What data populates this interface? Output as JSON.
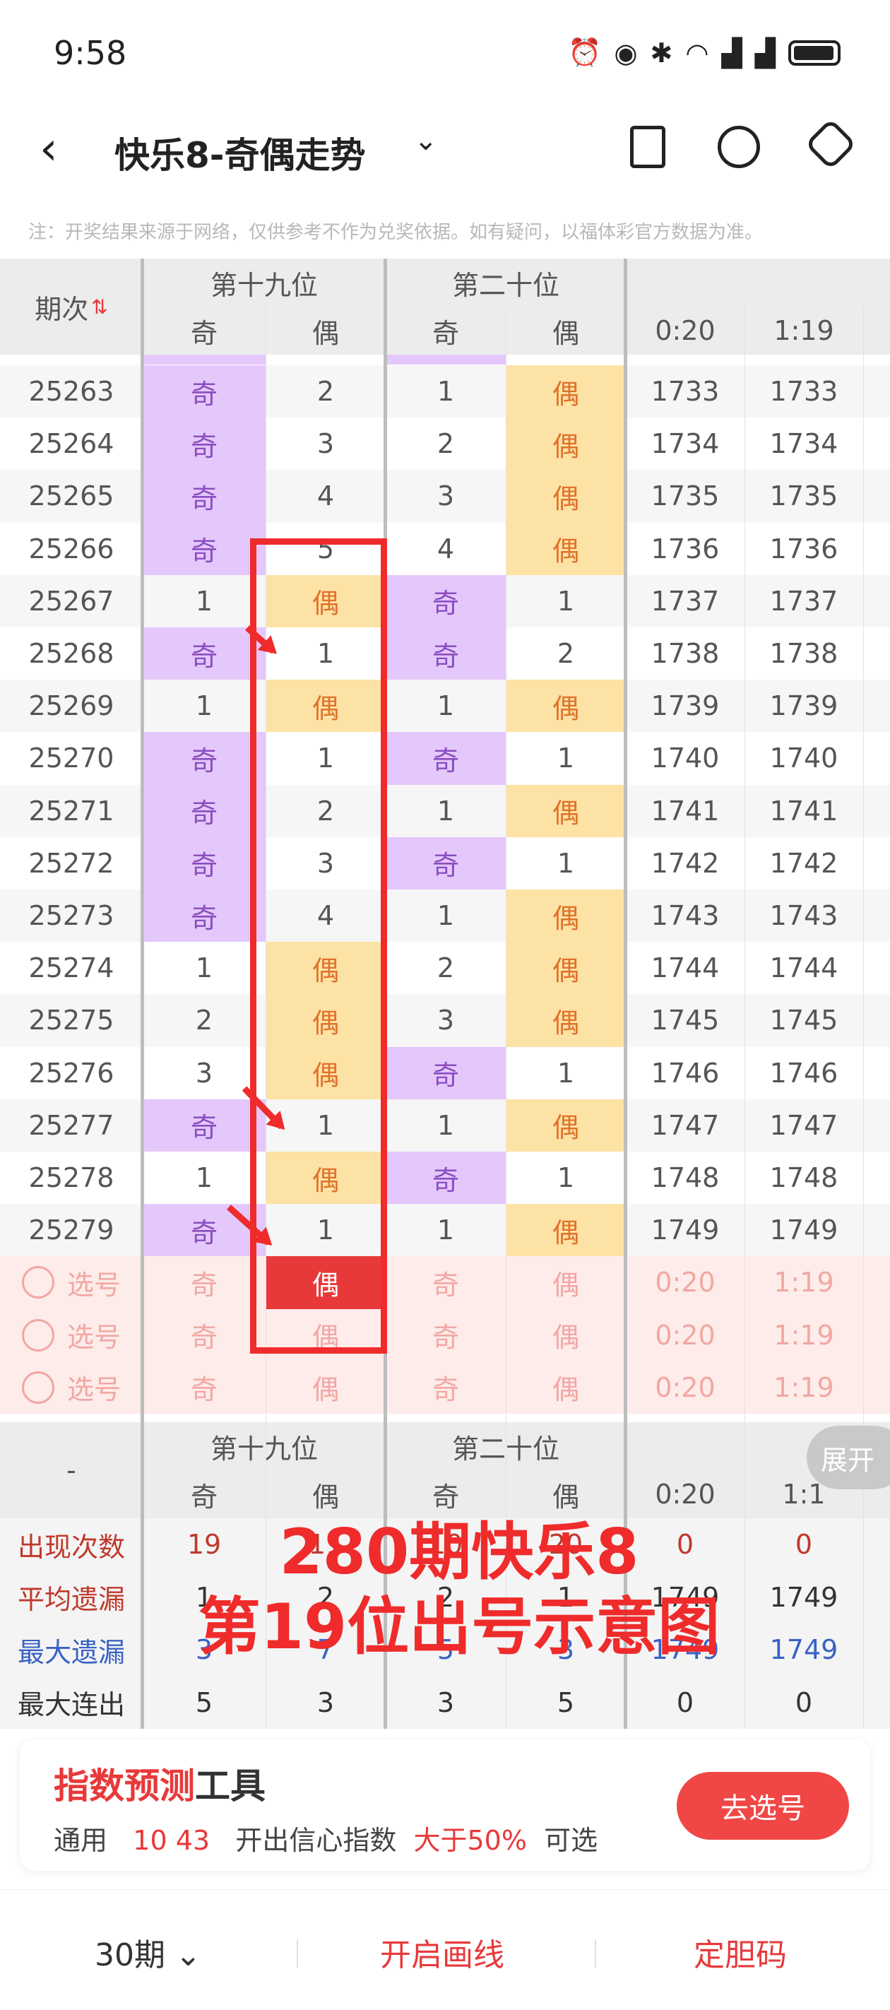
{
  "status_bar": {
    "time": "9:58",
    "icons": [
      "clock-icon",
      "eye-icon",
      "bluetooth-icon",
      "wifi-icon",
      "signal-icon",
      "signal-icon",
      "battery-icon"
    ]
  },
  "header": {
    "title": "快乐8-奇偶走势",
    "back_icon": "back-icon",
    "actions": [
      "phone-icon",
      "share-icon",
      "settings-icon"
    ]
  },
  "note": "注：开奖结果来源于网络，仅供参考不作为兑奖依据。如有疑问，以福体彩官方数据为准。",
  "table": {
    "period_header": "期次",
    "groups": [
      "第十九位",
      "第二十位"
    ],
    "sub_headers": [
      "奇",
      "偶",
      "奇",
      "偶",
      "0:20",
      "1:19"
    ],
    "rows": [
      {
        "period": "25263",
        "c19": [
          "奇",
          "2"
        ],
        "c20": [
          "1",
          "偶"
        ],
        "r": [
          "1733",
          "1733"
        ]
      },
      {
        "period": "25264",
        "c19": [
          "奇",
          "3"
        ],
        "c20": [
          "2",
          "偶"
        ],
        "r": [
          "1734",
          "1734"
        ]
      },
      {
        "period": "25265",
        "c19": [
          "奇",
          "4"
        ],
        "c20": [
          "3",
          "偶"
        ],
        "r": [
          "1735",
          "1735"
        ]
      },
      {
        "period": "25266",
        "c19": [
          "奇",
          "5"
        ],
        "c20": [
          "4",
          "偶"
        ],
        "r": [
          "1736",
          "1736"
        ]
      },
      {
        "period": "25267",
        "c19": [
          "1",
          "偶"
        ],
        "c20": [
          "奇",
          "1"
        ],
        "r": [
          "1737",
          "1737"
        ]
      },
      {
        "period": "25268",
        "c19": [
          "奇",
          "1"
        ],
        "c20": [
          "奇",
          "2"
        ],
        "r": [
          "1738",
          "1738"
        ]
      },
      {
        "period": "25269",
        "c19": [
          "1",
          "偶"
        ],
        "c20": [
          "1",
          "偶"
        ],
        "r": [
          "1739",
          "1739"
        ]
      },
      {
        "period": "25270",
        "c19": [
          "奇",
          "1"
        ],
        "c20": [
          "奇",
          "1"
        ],
        "r": [
          "1740",
          "1740"
        ]
      },
      {
        "period": "25271",
        "c19": [
          "奇",
          "2"
        ],
        "c20": [
          "1",
          "偶"
        ],
        "r": [
          "1741",
          "1741"
        ]
      },
      {
        "period": "25272",
        "c19": [
          "奇",
          "3"
        ],
        "c20": [
          "奇",
          "1"
        ],
        "r": [
          "1742",
          "1742"
        ]
      },
      {
        "period": "25273",
        "c19": [
          "奇",
          "4"
        ],
        "c20": [
          "1",
          "偶"
        ],
        "r": [
          "1743",
          "1743"
        ]
      },
      {
        "period": "25274",
        "c19": [
          "1",
          "偶"
        ],
        "c20": [
          "2",
          "偶"
        ],
        "r": [
          "1744",
          "1744"
        ]
      },
      {
        "period": "25275",
        "c19": [
          "2",
          "偶"
        ],
        "c20": [
          "3",
          "偶"
        ],
        "r": [
          "1745",
          "1745"
        ]
      },
      {
        "period": "25276",
        "c19": [
          "3",
          "偶"
        ],
        "c20": [
          "奇",
          "1"
        ],
        "r": [
          "1746",
          "1746"
        ]
      },
      {
        "period": "25277",
        "c19": [
          "奇",
          "1"
        ],
        "c20": [
          "1",
          "偶"
        ],
        "r": [
          "1747",
          "1747"
        ]
      },
      {
        "period": "25278",
        "c19": [
          "1",
          "偶"
        ],
        "c20": [
          "奇",
          "1"
        ],
        "r": [
          "1748",
          "1748"
        ]
      },
      {
        "period": "25279",
        "c19": [
          "奇",
          "1"
        ],
        "c20": [
          "1",
          "偶"
        ],
        "r": [
          "1749",
          "1749"
        ]
      }
    ],
    "pick_label": "选号",
    "pick_rows": [
      [
        "奇",
        "偶",
        "奇",
        "偶",
        "0:20",
        "1:19"
      ],
      [
        "奇",
        "偶",
        "奇",
        "偶",
        "0:20",
        "1:19"
      ],
      [
        "奇",
        "偶",
        "奇",
        "偶",
        "0:20",
        "1:19"
      ]
    ],
    "stats_corner": "-",
    "stats_groups": [
      "第十九位",
      "第二十位"
    ],
    "stats_sub_headers": [
      "奇",
      "偶",
      "奇",
      "偶",
      "0:20",
      "1:1"
    ],
    "stats": [
      {
        "label": "出现次数",
        "values": [
          "19",
          "11",
          "10",
          "20",
          "0",
          "0"
        ]
      },
      {
        "label": "平均遗漏",
        "values": [
          "1",
          "2",
          "2",
          "1",
          "1749",
          "1749"
        ]
      },
      {
        "label": "最大遗漏",
        "values": [
          "3",
          "7",
          "5",
          "3",
          "1749",
          "1749"
        ]
      },
      {
        "label": "最大连出",
        "values": [
          "5",
          "3",
          "3",
          "5",
          "0",
          "0"
        ]
      }
    ],
    "expand_label": "展开"
  },
  "overlay": {
    "line1": "280期快乐8",
    "line2": "第19位出号示意图"
  },
  "tool_card": {
    "title_red": "指数预测",
    "title_black": "工具",
    "line_prefix": "通用",
    "line_numbers": "10 43",
    "line_mid": "开出信心指数",
    "line_value": "大于50%",
    "line_suffix": "可选",
    "button": "去选号"
  },
  "bottom_bar": {
    "period_select": "30期",
    "draw_line": "开启画线",
    "set_code": "定胆码"
  },
  "colors": {
    "odd_bg": "#e4c8fb",
    "even_bg": "#fde2a6",
    "accent_red": "#e8393a"
  }
}
